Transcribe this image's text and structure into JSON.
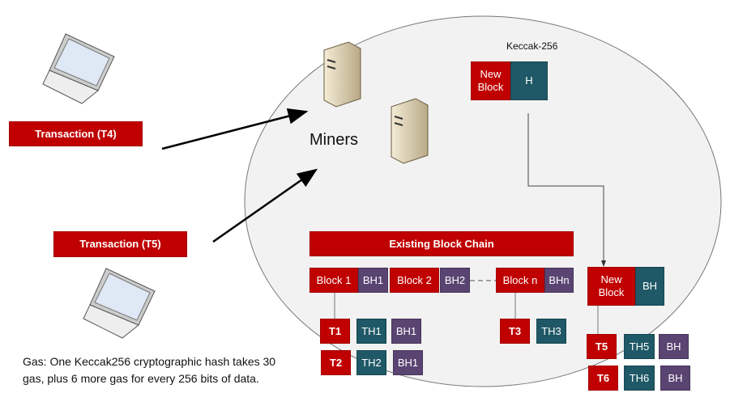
{
  "transactions": {
    "t4": "Transaction (T4)",
    "t5": "Transaction (T5)"
  },
  "miners_label": "Miners",
  "hash_label": "Keccak-256",
  "new_block_top": {
    "block": "New Block",
    "hash": "H"
  },
  "chain_title": "Existing Block Chain",
  "chain": [
    {
      "block": "Block 1",
      "hash": "BH1"
    },
    {
      "block": "Block 2",
      "hash": "BH2"
    },
    {
      "block": "Block n",
      "hash": "BHn"
    }
  ],
  "new_block_bottom": {
    "block": "New Block",
    "hash": "BH"
  },
  "tx_rows": [
    {
      "t": "T1",
      "th": "TH1",
      "bh": "BH1"
    },
    {
      "t": "T2",
      "th": "TH2",
      "bh": "BH1"
    },
    {
      "t": "T3",
      "th": "TH3"
    },
    {
      "t": "T5",
      "th": "TH5",
      "bh": "BH"
    },
    {
      "t": "T6",
      "th": "TH6",
      "bh": "BH"
    }
  ],
  "gas_note": "Gas:  One Keccak256 cryptographic hash takes 30 gas, plus  6 more gas for every 256 bits of data.",
  "colors": {
    "block": "#C00000",
    "tx_hash": "#1F5866",
    "block_hash": "#5A4472",
    "network": "#F2F2F2"
  }
}
